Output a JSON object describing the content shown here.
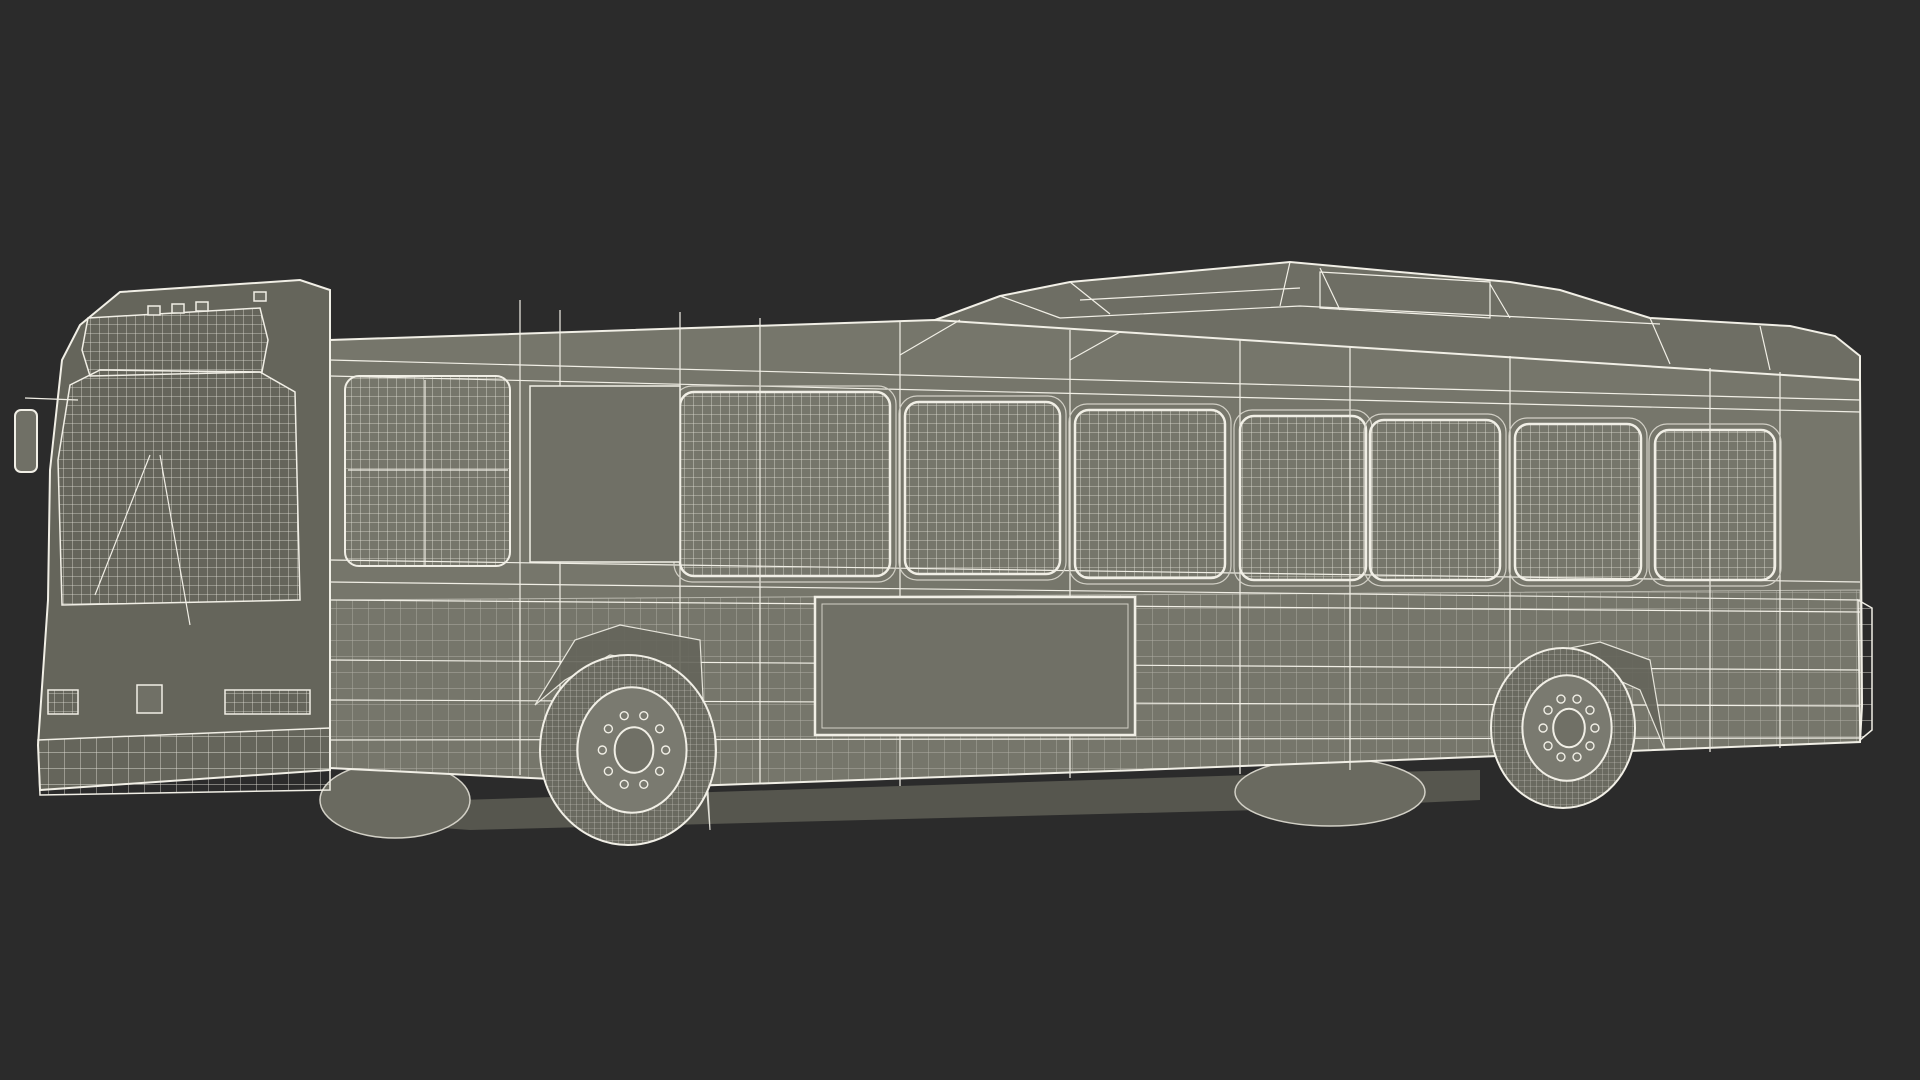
{
  "scene": {
    "subject": "city-bus-wireframe-render",
    "colors": {
      "background": "#2b2b2b",
      "body_fill": "#76766b",
      "body_fill_dark": "#65655b",
      "roof_fill": "#6e6e64",
      "window_fill": "#707066",
      "wheel_fill": "#7a7a70",
      "tire_fill": "#6a6a60",
      "shadow_fill": "#56564e",
      "wire": "#f1efe6",
      "wire_dim": "#d2d0c6"
    },
    "counts": {
      "side_windows": 9,
      "wheels_visible": 4,
      "marker_lights_front_roof": 4
    }
  }
}
